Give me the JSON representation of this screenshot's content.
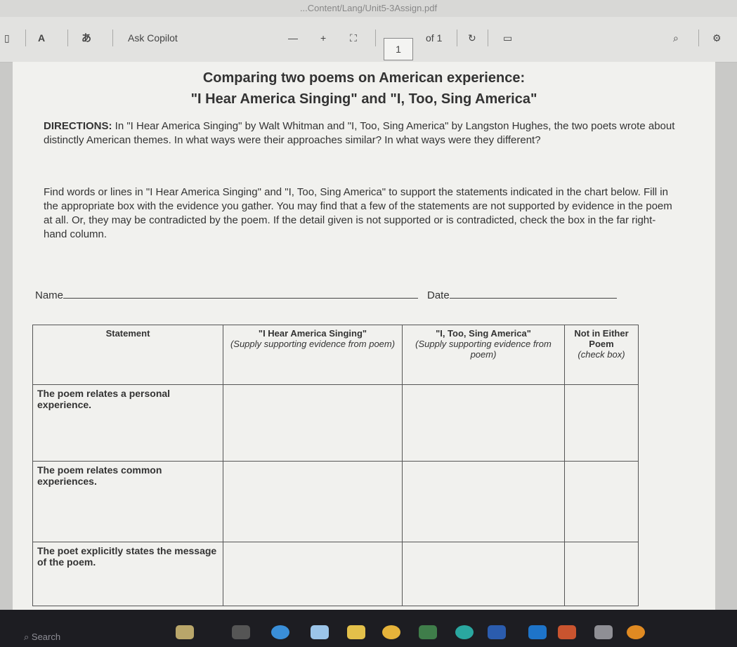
{
  "browser": {
    "address": "...Content/Lang/Unit5-3Assign.pdf"
  },
  "toolbar": {
    "read_aloud_label": "A",
    "ai_label": "Ask Copilot",
    "draw_label": "—",
    "add_label": "+",
    "current_page": "1",
    "page_total": "of 1"
  },
  "document": {
    "title_line1": "Comparing two poems on American experience:",
    "title_line2": "\"I Hear America Singing\" and \"I, Too, Sing America\"",
    "directions_label": "DIRECTIONS:",
    "directions_text": "In \"I Hear America Singing\" by Walt Whitman and \"I, Too, Sing America\" by Langston Hughes, the two poets wrote about distinctly American themes. In what ways were their approaches similar? In what ways were they different?",
    "instructions": "Find words or lines in \"I Hear America Singing\" and \"I, Too, Sing America\" to support the statements indicated in the chart below. Fill in the appropriate box with the evidence you gather. You may find that a few of the statements are not supported by evidence in the poem at all. Or, they may be contradicted by the poem. If the detail given is not supported or is contradicted, check the box in the far right-hand column.",
    "name_label": "Name",
    "date_label": "Date"
  },
  "table": {
    "headers": [
      {
        "title": "Statement",
        "sub": ""
      },
      {
        "title": "\"I Hear America Singing\"",
        "sub": "(Supply supporting evidence from poem)"
      },
      {
        "title": "\"I, Too, Sing America\"",
        "sub": "(Supply supporting evidence from poem)"
      },
      {
        "title": "Not in Either Poem",
        "sub": "(check box)"
      }
    ],
    "rows": [
      {
        "statement": "The poem relates a personal experience."
      },
      {
        "statement": "The poem relates common experiences."
      },
      {
        "statement": "The poet explicitly states the message of the poem."
      }
    ]
  },
  "taskbar": {
    "search_placeholder": "Search",
    "icons": [
      "weather-icon",
      "widgets-icon",
      "browser-icon",
      "store-icon",
      "files-icon",
      "chrome-icon",
      "app-icon",
      "edge-icon",
      "word-icon",
      "outlook-icon",
      "teams-icon",
      "game-icon",
      "security-icon"
    ]
  },
  "colors": {
    "page_bg": "#f1f1ee",
    "toolbar_bg": "#e2e2e0",
    "taskbar_bg": "#1d1d22"
  }
}
